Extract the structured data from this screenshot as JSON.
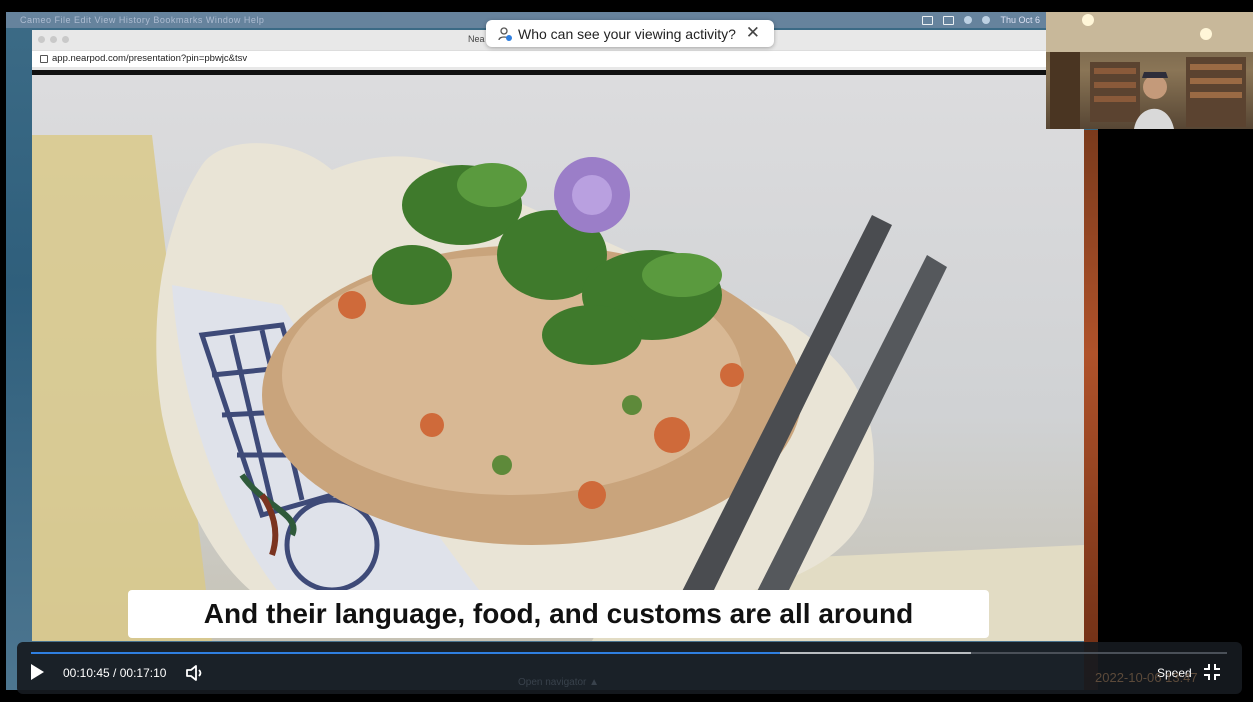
{
  "menubar": {
    "items": "Cameo  File  Edit  View  History  Bookmarks  Window  Help",
    "clock": "Thu Oct 6"
  },
  "browser": {
    "tab_title": "Nea",
    "url": "app.nearpod.com/presentation?pin=pbwjc&tsv"
  },
  "toast": {
    "text": "Who can see your viewing activity?",
    "close": "✕"
  },
  "video": {
    "caption": "And their language, food, and customs are all around",
    "progress_fraction": 0.626,
    "buffered_fraction": 0.786
  },
  "controls": {
    "current_time": "00:10:45",
    "separator": " / ",
    "duration": "00:17:10",
    "speed_label": "Speed"
  },
  "footer": {
    "navigator_hint": "Open navigator ▲",
    "timestamp": "2022-10-06 13:47"
  },
  "icons": {
    "play": "play-icon",
    "volume": "volume-icon",
    "fullscreen_exit": "exit-fullscreen-icon",
    "close": "close-icon",
    "viewer": "person-eye-icon"
  },
  "colors": {
    "progress": "#2f7fe0",
    "controls_bg": "#161a20",
    "caption_bg": "#ffffff"
  }
}
